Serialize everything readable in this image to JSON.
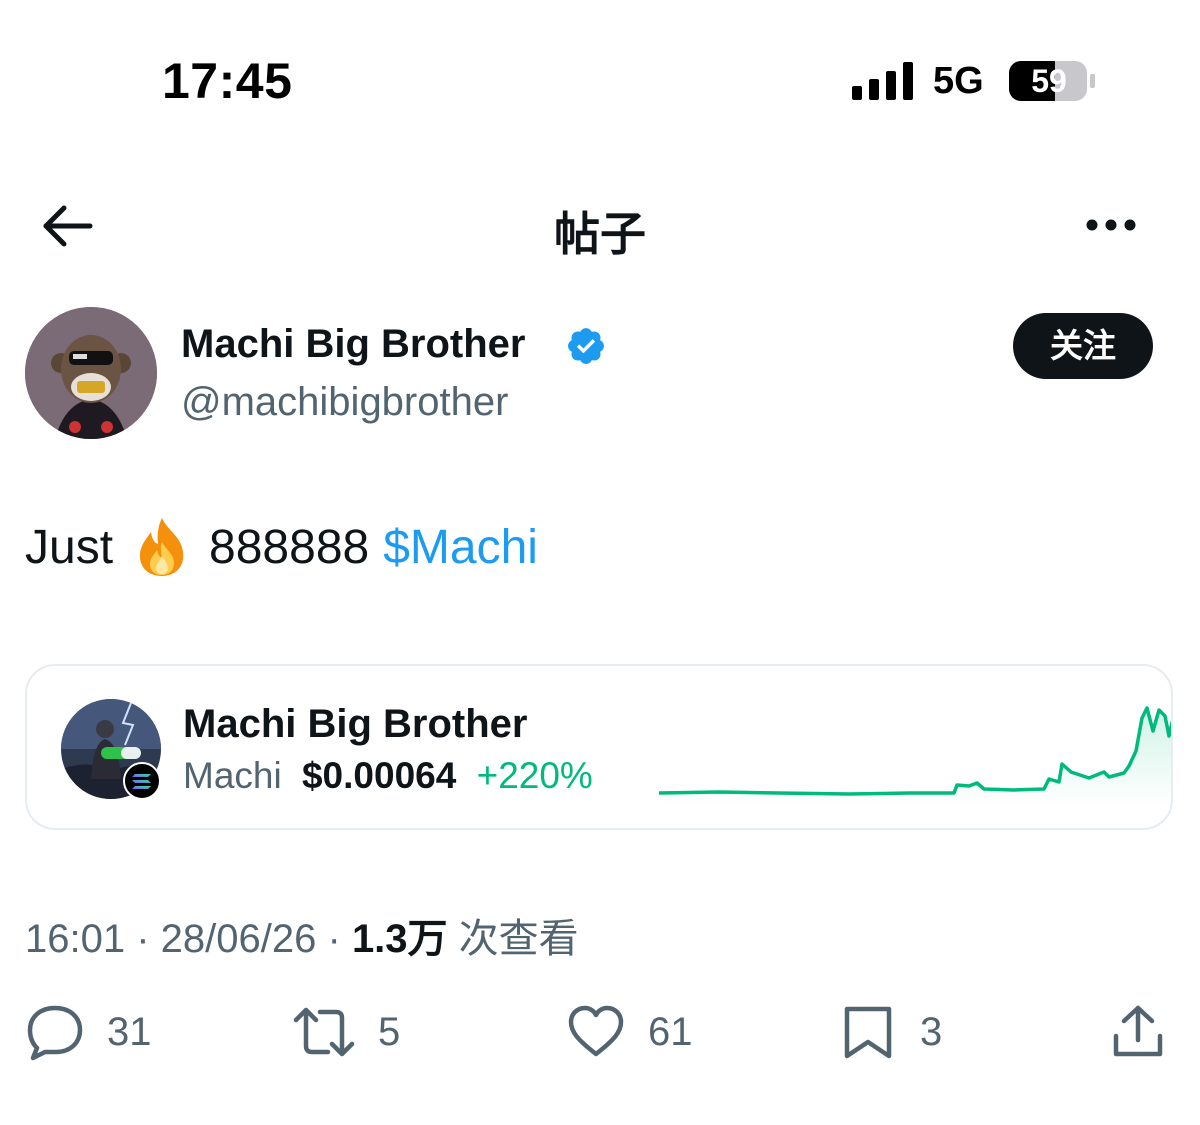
{
  "status_bar": {
    "time": "17:45",
    "network": "5G",
    "battery": "59"
  },
  "nav": {
    "title": "帖子",
    "back_icon": "arrow-left-icon",
    "more_icon": "more-horizontal-icon"
  },
  "author": {
    "display_name": "Machi Big Brother",
    "handle": "@machibigbrother",
    "verified": true,
    "follow_label": "关注"
  },
  "tweet": {
    "text_prefix": "Just",
    "emoji": "fire-emoji",
    "text_number": "888888",
    "cashtag": "$Machi"
  },
  "token_card": {
    "name": "Machi Big Brother",
    "symbol": "Machi",
    "price": "$0.00064",
    "change": "+220%",
    "chain_icon": "solana-icon",
    "change_color": "#00ba7c"
  },
  "meta": {
    "time": "16:01",
    "date": "28/06/26",
    "views_value": "1.3万",
    "views_label": "次查看"
  },
  "actions": {
    "replies": "31",
    "reposts": "5",
    "likes": "61",
    "bookmarks": "3"
  },
  "colors": {
    "accent": "#1d9bf0",
    "text": "#0f1419",
    "secondary": "#536471",
    "positive": "#00ba7c"
  }
}
